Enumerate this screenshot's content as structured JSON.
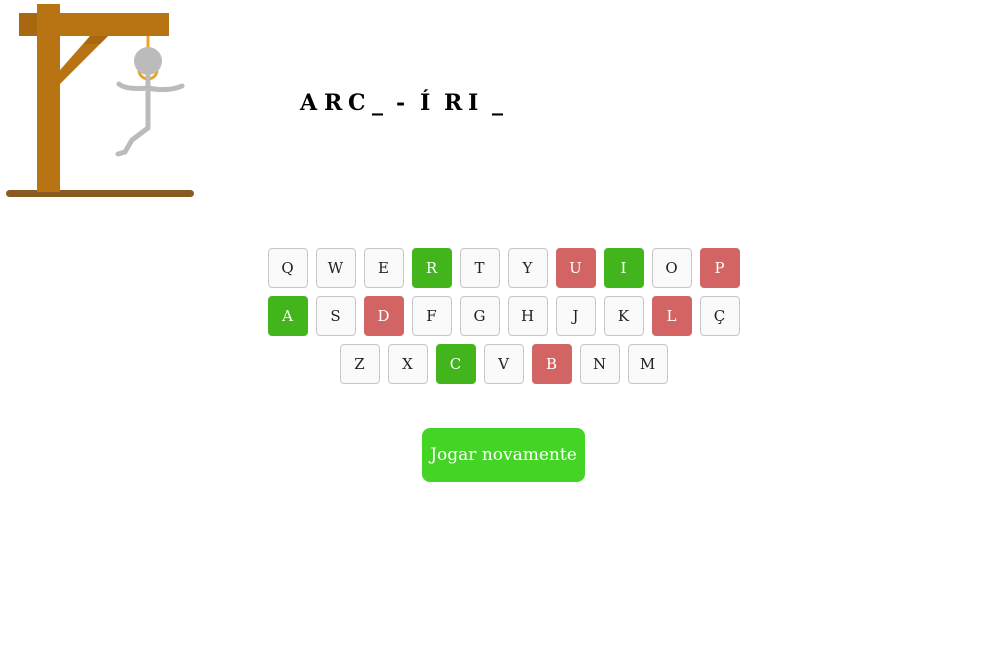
{
  "word": {
    "letters": [
      "A",
      "R",
      "C",
      "_",
      "-",
      "Í",
      "R",
      "I",
      "_"
    ]
  },
  "keyboard": {
    "rows": [
      [
        {
          "label": "Q",
          "state": "unused"
        },
        {
          "label": "W",
          "state": "unused"
        },
        {
          "label": "E",
          "state": "unused"
        },
        {
          "label": "R",
          "state": "correct"
        },
        {
          "label": "T",
          "state": "unused"
        },
        {
          "label": "Y",
          "state": "unused"
        },
        {
          "label": "U",
          "state": "wrong"
        },
        {
          "label": "I",
          "state": "correct"
        },
        {
          "label": "O",
          "state": "unused"
        },
        {
          "label": "P",
          "state": "wrong"
        }
      ],
      [
        {
          "label": "A",
          "state": "correct"
        },
        {
          "label": "S",
          "state": "unused"
        },
        {
          "label": "D",
          "state": "wrong"
        },
        {
          "label": "F",
          "state": "unused"
        },
        {
          "label": "G",
          "state": "unused"
        },
        {
          "label": "H",
          "state": "unused"
        },
        {
          "label": "J",
          "state": "unused"
        },
        {
          "label": "K",
          "state": "unused"
        },
        {
          "label": "L",
          "state": "wrong"
        },
        {
          "label": "Ç",
          "state": "unused"
        }
      ],
      [
        {
          "label": "Z",
          "state": "unused"
        },
        {
          "label": "X",
          "state": "unused"
        },
        {
          "label": "C",
          "state": "correct"
        },
        {
          "label": "V",
          "state": "unused"
        },
        {
          "label": "B",
          "state": "wrong"
        },
        {
          "label": "N",
          "state": "unused"
        },
        {
          "label": "M",
          "state": "unused"
        }
      ]
    ]
  },
  "actions": {
    "play_again_label": "Jogar novamente"
  },
  "colors": {
    "correct": "#43b51c",
    "wrong": "#d26464",
    "play_again": "#44d426",
    "gallows_wood": "#b87413",
    "gallows_base": "#8a5a22",
    "rope": "#e8a626",
    "figure": "#bbbbbb"
  },
  "icons": {
    "gallows": "gallows-illustration",
    "figure": "hangman-figure"
  }
}
